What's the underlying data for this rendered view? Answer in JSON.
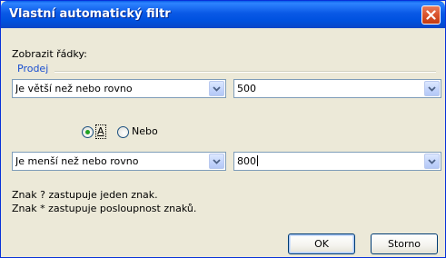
{
  "dialog": {
    "title": "Vlastní automatický filtr",
    "show_rows_label": "Zobrazit řádky:",
    "field_name": "Prodej"
  },
  "criteria1": {
    "operator": "Je větší než nebo rovno",
    "value": "500"
  },
  "logic": {
    "and_label": "A",
    "or_label": "Nebo",
    "selected": "A"
  },
  "criteria2": {
    "operator": "Je menší než nebo rovno",
    "value": "800"
  },
  "help": {
    "line1": "Znak ? zastupuje jeden znak.",
    "line2": "Znak * zastupuje posloupnost znaků."
  },
  "buttons": {
    "ok": "OK",
    "cancel": "Storno"
  },
  "colors": {
    "titlebar": "#0a59e6",
    "close": "#d9532c",
    "group_label": "#1a4fd0",
    "dialog_bg": "#ece9d8"
  }
}
